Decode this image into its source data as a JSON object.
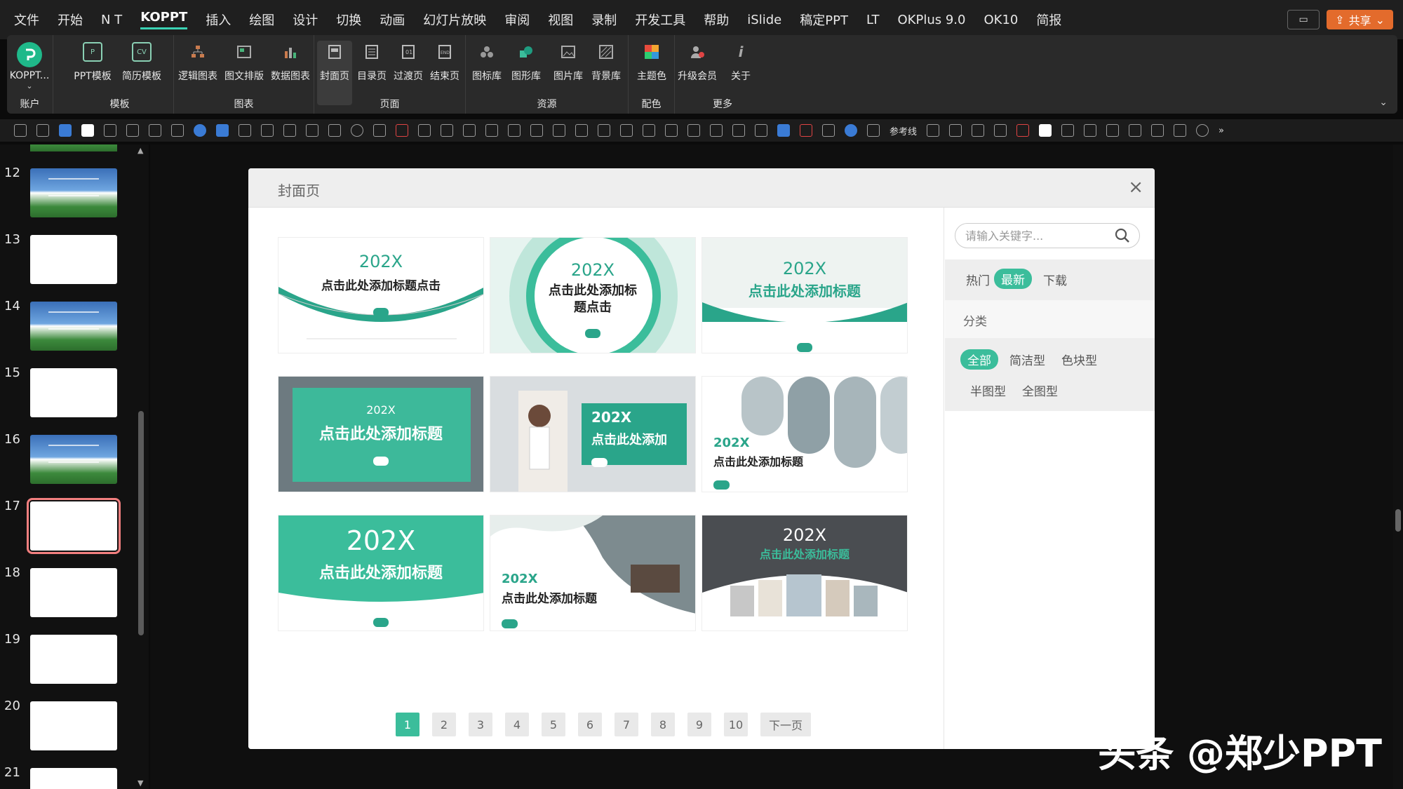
{
  "menu": {
    "items": [
      "文件",
      "开始",
      "N T",
      "KOPPT",
      "插入",
      "绘图",
      "设计",
      "切换",
      "动画",
      "幻灯片放映",
      "审阅",
      "视图",
      "录制",
      "开发工具",
      "帮助",
      "iSlide",
      "稿定PPT",
      "LT",
      "OKPlus 9.0",
      "OK10",
      "简报"
    ],
    "active": "KOPPT",
    "share_label": "共享"
  },
  "ribbon": {
    "groups": [
      {
        "label": "账户",
        "buttons": [
          {
            "label": "KOPPT...",
            "icon": "koppt-logo-icon"
          }
        ]
      },
      {
        "label": "模板",
        "buttons": [
          {
            "label": "PPT模板",
            "icon": "ppt-template-icon"
          },
          {
            "label": "简历模板",
            "icon": "resume-template-icon"
          }
        ]
      },
      {
        "label": "图表",
        "buttons": [
          {
            "label": "逻辑图表",
            "icon": "logic-chart-icon"
          },
          {
            "label": "图文排版",
            "icon": "image-text-layout-icon"
          },
          {
            "label": "数据图表",
            "icon": "data-chart-icon"
          }
        ]
      },
      {
        "label": "页面",
        "buttons": [
          {
            "label": "封面页",
            "icon": "cover-page-icon"
          },
          {
            "label": "目录页",
            "icon": "toc-page-icon"
          },
          {
            "label": "过渡页",
            "icon": "transition-page-icon"
          },
          {
            "label": "结束页",
            "icon": "end-page-icon"
          }
        ]
      },
      {
        "label": "资源",
        "buttons": [
          {
            "label": "图标库",
            "icon": "icon-library-icon"
          },
          {
            "label": "图形库",
            "icon": "shape-library-icon"
          },
          {
            "label": "图片库",
            "icon": "image-library-icon"
          },
          {
            "label": "背景库",
            "icon": "background-library-icon"
          }
        ]
      },
      {
        "label": "配色",
        "buttons": [
          {
            "label": "主题色",
            "icon": "theme-color-icon"
          }
        ]
      },
      {
        "label": "更多",
        "buttons": [
          {
            "label": "升级会员",
            "icon": "upgrade-member-icon"
          },
          {
            "label": "关于",
            "icon": "info-icon"
          }
        ]
      }
    ]
  },
  "quickbar": {
    "reference_line_label": "参考线"
  },
  "slides": [
    {
      "num": "12",
      "type": "pic"
    },
    {
      "num": "13",
      "type": "blank"
    },
    {
      "num": "14",
      "type": "pic"
    },
    {
      "num": "15",
      "type": "blank"
    },
    {
      "num": "16",
      "type": "pic"
    },
    {
      "num": "17",
      "type": "blank",
      "selected": true
    },
    {
      "num": "18",
      "type": "blank"
    },
    {
      "num": "19",
      "type": "blank"
    },
    {
      "num": "20",
      "type": "blank"
    },
    {
      "num": "21",
      "type": "blank"
    }
  ],
  "dialog": {
    "title": "封面页",
    "close_symbol": "×",
    "templates": [
      {
        "year": "202X",
        "title": "点击此处添加标题点击"
      },
      {
        "year": "202X",
        "title": "点击此处添加标题点击"
      },
      {
        "year": "202X",
        "title": "点击此处添加标题"
      },
      {
        "year": "202X",
        "title": "点击此处添加标题"
      },
      {
        "year": "202X",
        "title": "点击此处添加"
      },
      {
        "year": "202X",
        "title": "点击此处添加标题"
      },
      {
        "year": "202X",
        "title": "点击此处添加标题"
      },
      {
        "year": "202X",
        "title": "点击此处添加标题"
      },
      {
        "year": "202X",
        "title": "点击此处添加标题"
      }
    ],
    "pagination": {
      "pages": [
        "1",
        "2",
        "3",
        "4",
        "5",
        "6",
        "7",
        "8",
        "9",
        "10"
      ],
      "current": "1",
      "next_label": "下一页"
    },
    "search": {
      "placeholder": "请输入关键字..."
    },
    "sort_tabs": [
      "热门",
      "最新",
      "下载"
    ],
    "sort_active": "最新",
    "category_heading": "分类",
    "category_tabs": [
      "全部",
      "简洁型",
      "色块型",
      "半图型",
      "全图型"
    ],
    "category_active": "全部"
  },
  "watermark": "头条 @郑少PPT",
  "colors": {
    "accent": "#3bbd9b",
    "template_green": "#2aa58a",
    "share_orange": "#e36b2c",
    "selected_slide_outline": "#f27f7f"
  }
}
